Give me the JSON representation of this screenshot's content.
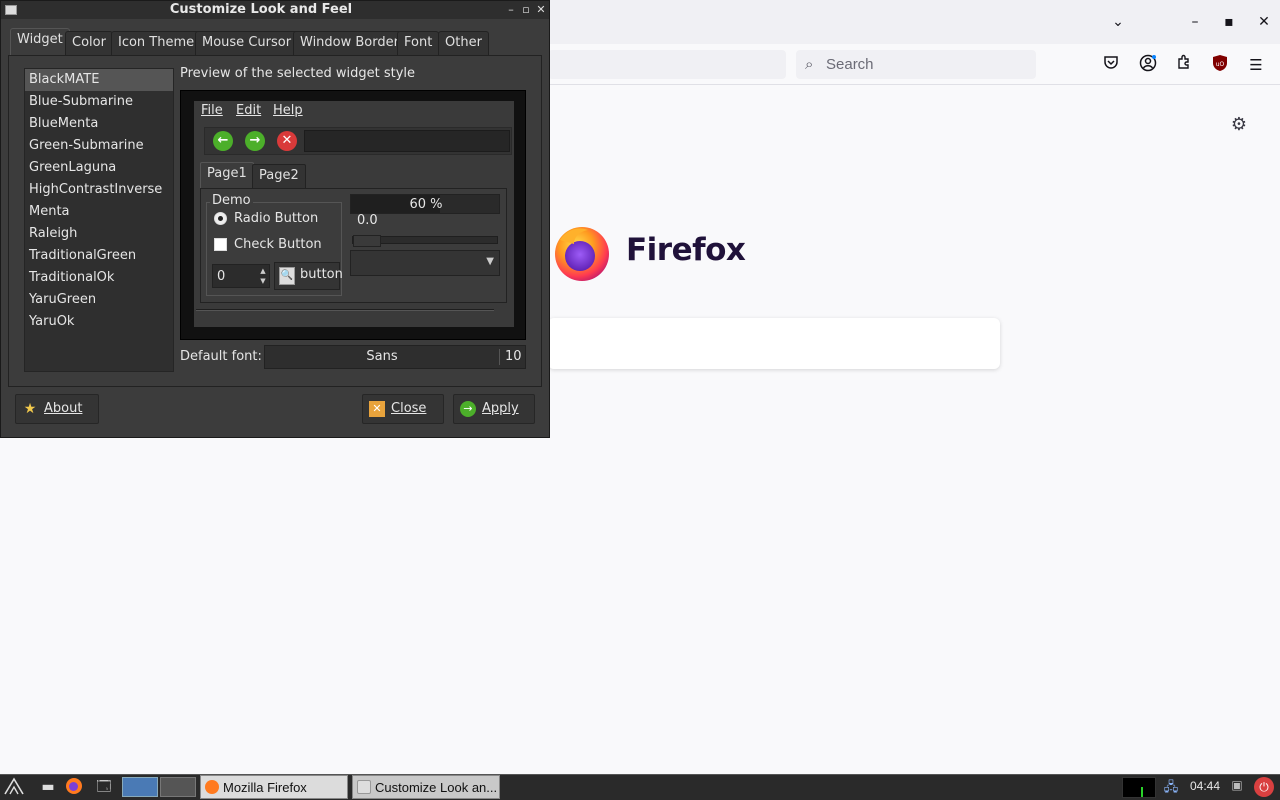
{
  "firefox": {
    "search": {
      "placeholder": "Search"
    },
    "brand": "Firefox",
    "window_controls": {
      "list_all_tabs": "⌄",
      "minimize": "–",
      "maximize": "▪",
      "close": "✕"
    },
    "toolbar_icons": [
      "pocket-icon",
      "account-icon",
      "extensions-icon",
      "ublock-icon",
      "menu-icon"
    ]
  },
  "dialog": {
    "title": "Customize Look and Feel",
    "tabs": [
      {
        "label": "Widget",
        "active": true
      },
      {
        "label": "Color"
      },
      {
        "label": "Icon Theme"
      },
      {
        "label": "Mouse Cursor"
      },
      {
        "label": "Window Border"
      },
      {
        "label": "Font"
      },
      {
        "label": "Other"
      }
    ],
    "themes": [
      "BlackMATE",
      "Blue-Submarine",
      "BlueMenta",
      "Green-Submarine",
      "GreenLaguna",
      "HighContrastInverse",
      "Menta",
      "Raleigh",
      "TraditionalGreen",
      "TraditionalOk",
      "YaruGreen",
      "YaruOk"
    ],
    "selected_theme": "BlackMATE",
    "preview_label": "Preview of the selected widget style",
    "preview": {
      "menu": [
        "File",
        "Edit",
        "Help"
      ],
      "tabs": [
        "Page1",
        "Page2"
      ],
      "frame_label": "Demo",
      "radio_label": "Radio Button",
      "check_label": "Check Button",
      "spin_value": "0",
      "button_label": "button",
      "progress_text": "60 %",
      "progress_fraction": 0.6,
      "scale_value": "0.0"
    },
    "default_font_label": "Default font:",
    "font_name": "Sans",
    "font_size": "10",
    "buttons": {
      "about": "About",
      "close": "Close",
      "apply": "Apply"
    }
  },
  "taskbar": {
    "tasks": [
      {
        "label": "Mozilla Firefox"
      },
      {
        "label": "Customize Look an..."
      }
    ],
    "clock": "04:44"
  },
  "colors": {
    "dialog_bg": "#3c3c3c",
    "firefox_bg": "#f9f9fb",
    "accent_green": "#4caf2a",
    "accent_red": "#d93a3a"
  }
}
